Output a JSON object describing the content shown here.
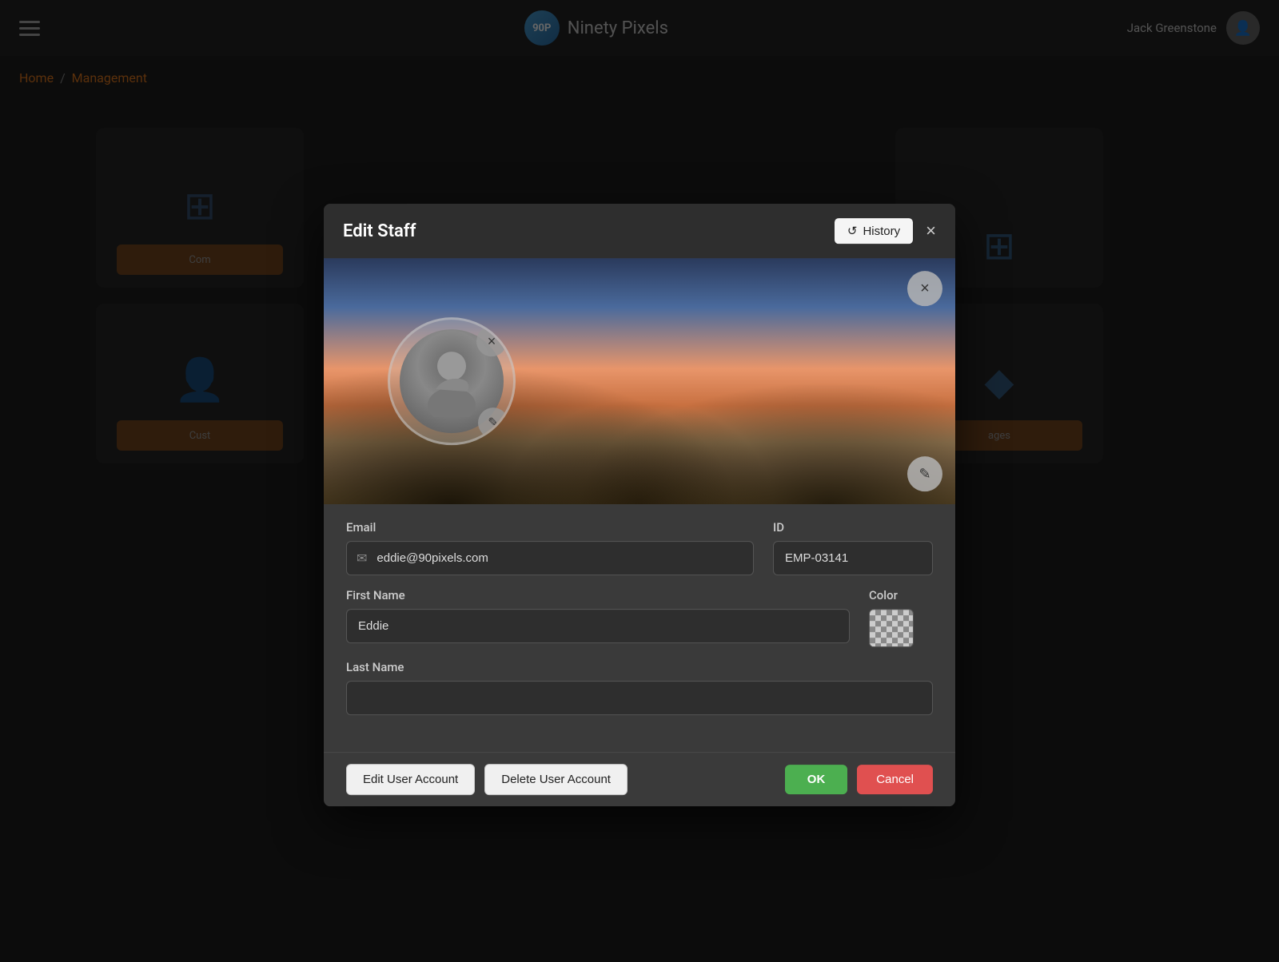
{
  "app": {
    "logo_text": "90P",
    "brand_name": "Ninety Pixels",
    "user_name": "Jack Greenstone"
  },
  "breadcrumb": {
    "home": "Home",
    "separator": "/",
    "current": "Management"
  },
  "modal": {
    "title": "Edit Staff",
    "history_btn": "History",
    "close_icon": "×",
    "avatar_remove_icon": "×",
    "avatar_edit_icon": "✎",
    "banner_remove_icon": "×",
    "banner_edit_icon": "✎",
    "fields": {
      "email_label": "Email",
      "email_value": "eddie@90pixels.com",
      "email_placeholder": "Email",
      "id_label": "ID",
      "id_value": "EMP-03141",
      "firstname_label": "First Name",
      "firstname_value": "Eddie",
      "color_label": "Color",
      "lastname_label": "Last Name",
      "lastname_value": ""
    },
    "footer": {
      "edit_account_btn": "Edit User Account",
      "delete_account_btn": "Delete User Account",
      "ok_btn": "OK",
      "cancel_btn": "Cancel"
    }
  },
  "background": {
    "card1_label": "Com",
    "card2_label": "Cust",
    "card2_btn2": "ages"
  }
}
